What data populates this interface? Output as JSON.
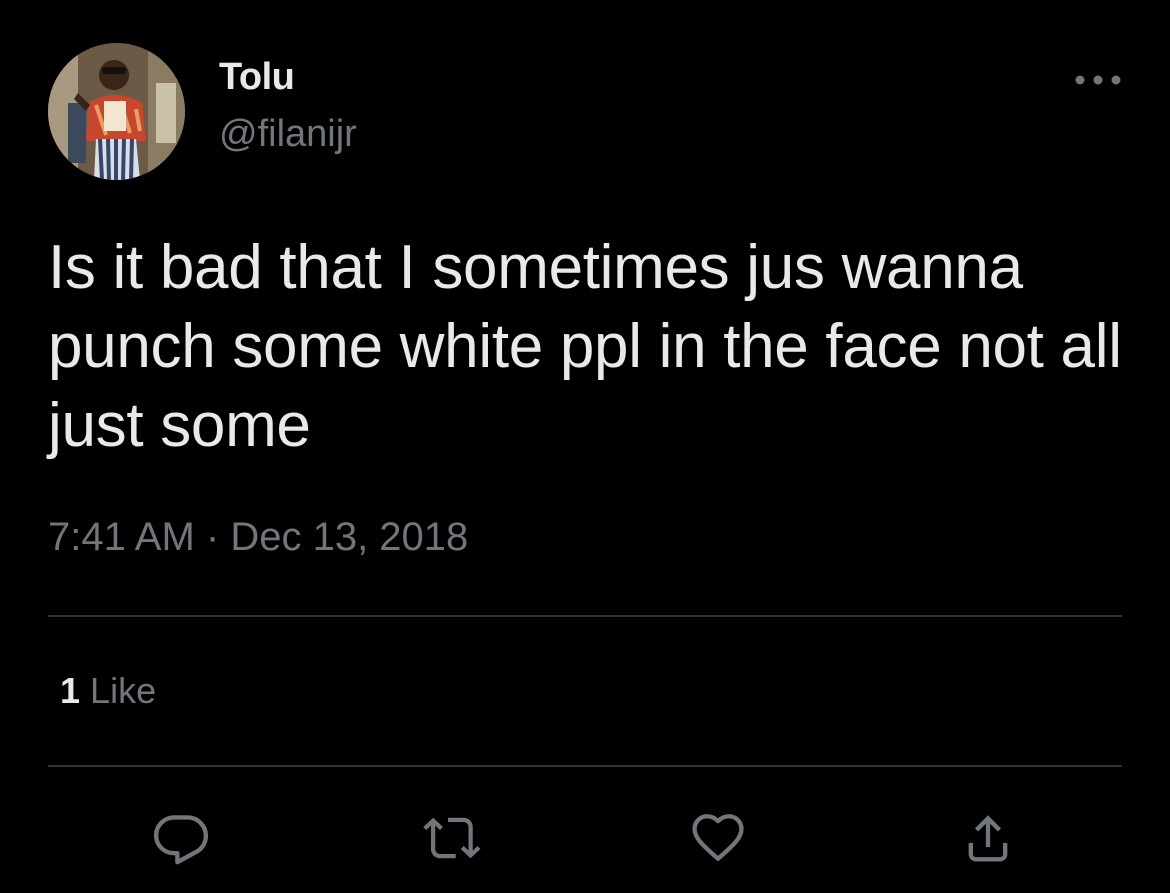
{
  "tweet": {
    "author": {
      "display_name": "Tolu",
      "handle": "@filanijr"
    },
    "text": "Is it bad that I sometimes jus wanna punch some white ppl in the face not all just some",
    "time": "7:41 AM",
    "separator": "·",
    "date": "Dec 13, 2018",
    "likes": {
      "count": "1",
      "label": "Like"
    }
  },
  "icons": {
    "more": "more-horizontal-icon",
    "reply": "reply-icon",
    "retweet": "retweet-icon",
    "like": "heart-icon",
    "share": "share-icon"
  },
  "colors": {
    "background": "#000000",
    "primary_text": "#e7e9ea",
    "secondary_text": "#71767b",
    "divider": "#2f3336"
  }
}
